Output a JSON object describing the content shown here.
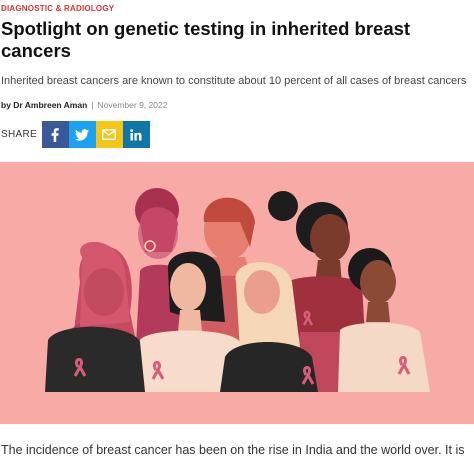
{
  "article": {
    "category": "DIAGNOSTIC & RADIOLOGY",
    "title": "Spotlight on genetic testing in inherited breast cancers",
    "subtitle": "Inherited breast cancers are known to constitute about 10 percent of all cases of breast cancers",
    "author": "by Dr Ambreen Aman",
    "separator": "|",
    "date": "November 9, 2022",
    "body_start": "The incidence of breast cancer has been on the rise in India and the world over. It is"
  },
  "share": {
    "label": "SHARE",
    "buttons": [
      {
        "icon": "facebook-icon",
        "color": "#3b5998"
      },
      {
        "icon": "twitter-icon",
        "color": "#1da1f2"
      },
      {
        "icon": "email-icon",
        "color": "#f5c518"
      },
      {
        "icon": "linkedin-icon",
        "color": "#0e76a8"
      }
    ]
  },
  "hero": {
    "background": "#f8aaa6",
    "accent": "#d95c7c"
  }
}
